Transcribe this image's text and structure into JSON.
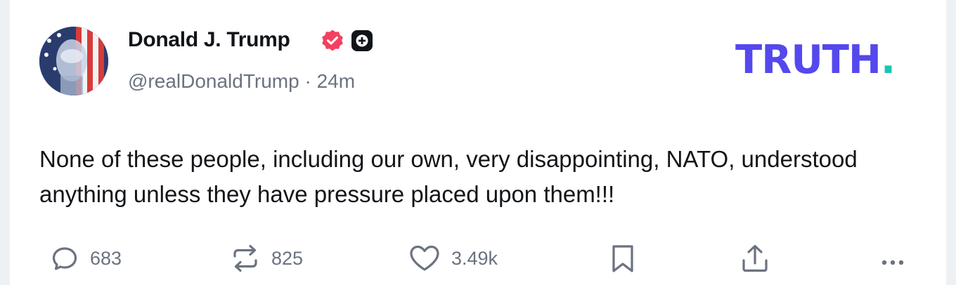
{
  "post": {
    "author": {
      "display_name": "Donald J. Trump",
      "handle": "@realDonaldTrump",
      "verified": true
    },
    "time_ago": "24m",
    "separator": "·",
    "text": "None of these people, including our own, very disappointing, NATO, understood anything unless they have pressure placed upon them!!!"
  },
  "brand": {
    "logo_text": "TRUTH",
    "logo_dot": ".",
    "logo_color": "#5448ee",
    "dot_color": "#17c7b0"
  },
  "actions": {
    "replies": {
      "icon": "comment-icon",
      "count": "683"
    },
    "retruths": {
      "icon": "repost-icon",
      "count": "825"
    },
    "likes": {
      "icon": "heart-icon",
      "count": "3.49k"
    },
    "bookmark": {
      "icon": "bookmark-icon"
    },
    "share": {
      "icon": "share-icon"
    },
    "more": {
      "icon": "more-icon"
    }
  },
  "colors": {
    "verified_badge": "#f43f5e",
    "text_primary": "#111418",
    "text_secondary": "#6b7280"
  }
}
